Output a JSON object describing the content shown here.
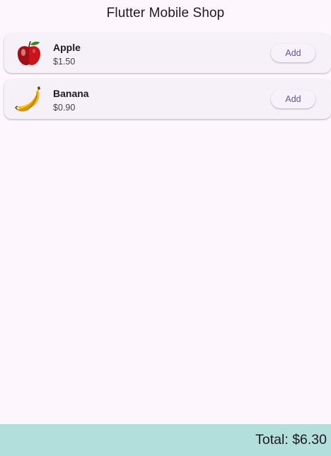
{
  "app_bar": {
    "title": "Flutter Mobile Shop"
  },
  "products": [
    {
      "name": "Apple",
      "price": "$1.50",
      "add_label": "Add",
      "icon": "apple-icon"
    },
    {
      "name": "Banana",
      "price": "$0.90",
      "add_label": "Add",
      "icon": "banana-icon"
    }
  ],
  "footer": {
    "total": "Total: $6.30"
  },
  "colors": {
    "background": "#fdf7fd",
    "card": "#f6f1f8",
    "accent": "#6750a4",
    "bottom_bar": "#b2dfdb"
  }
}
